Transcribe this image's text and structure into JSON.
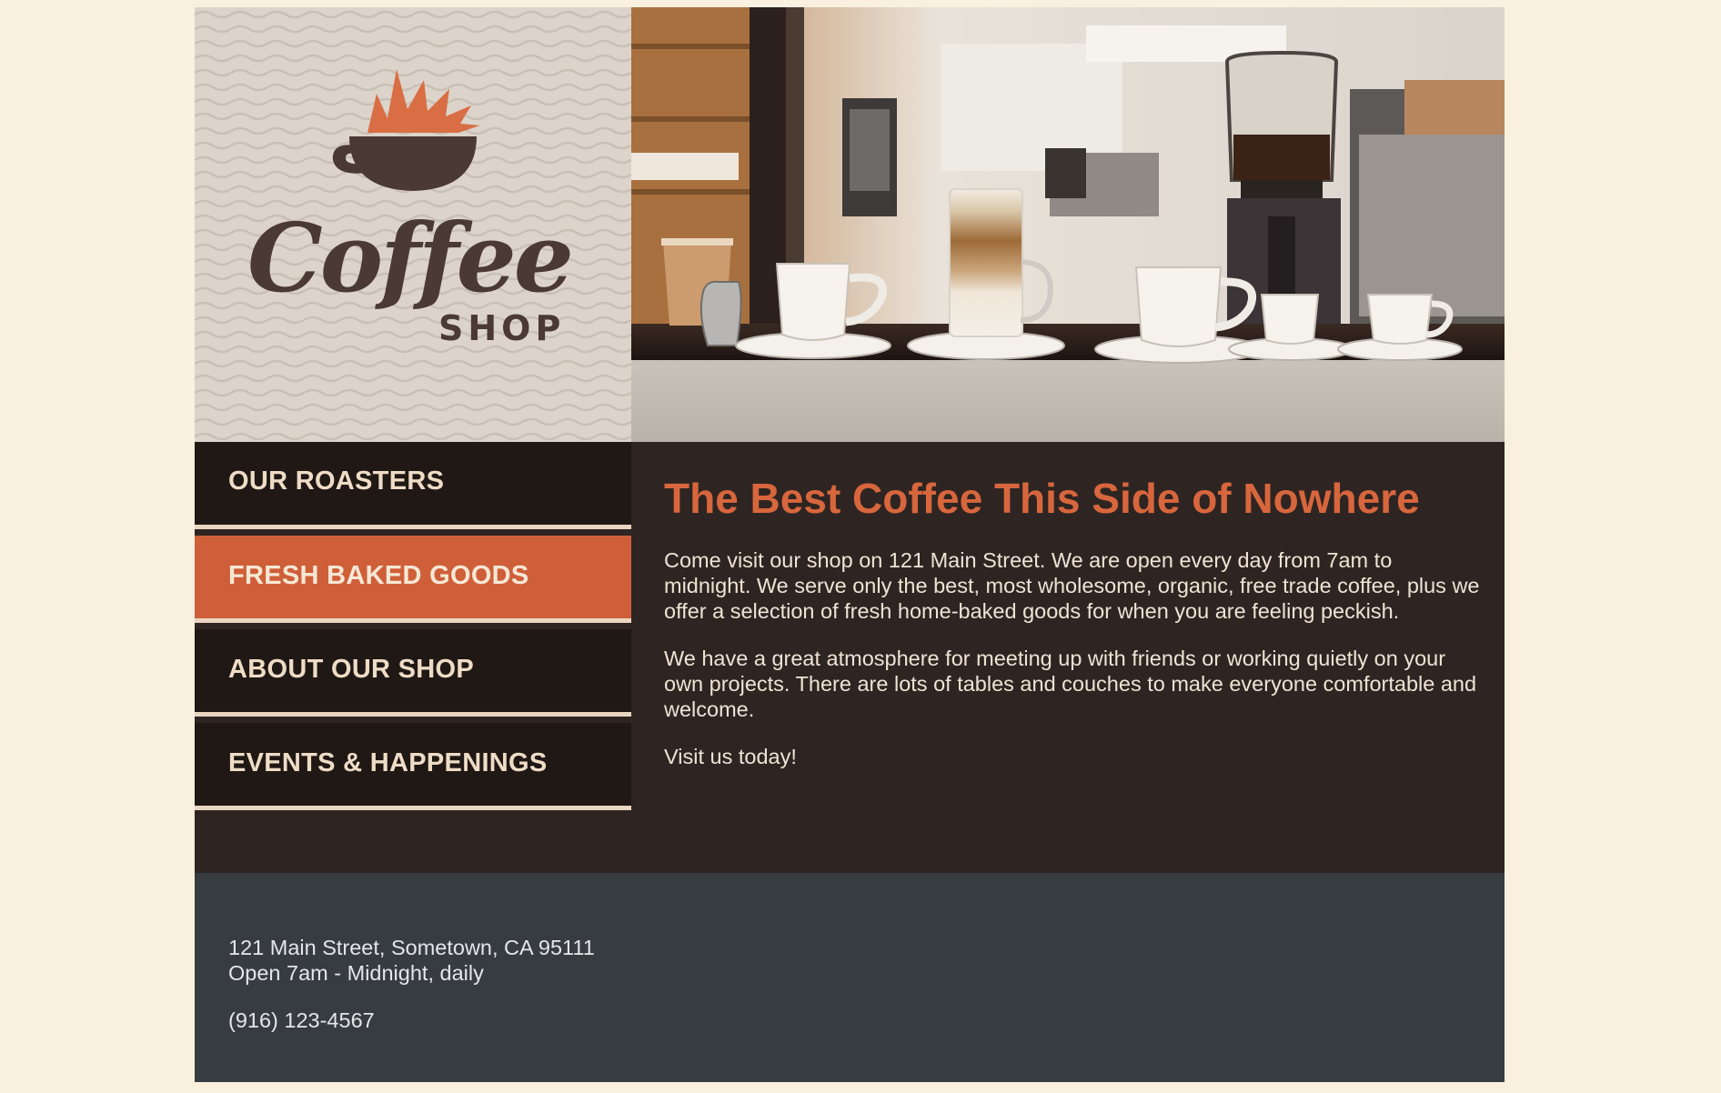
{
  "logo": {
    "word": "Coffee",
    "sub": "SHOP"
  },
  "hero": {
    "icon": "cafe-counter-photo"
  },
  "nav": {
    "items": [
      {
        "label": "OUR ROASTERS",
        "active": false
      },
      {
        "label": "FRESH BAKED GOODS",
        "active": true
      },
      {
        "label": "ABOUT OUR SHOP",
        "active": false
      },
      {
        "label": "EVENTS & HAPPENINGS",
        "active": false
      }
    ]
  },
  "content": {
    "title": "The Best Coffee This Side of Nowhere",
    "paragraphs": [
      "Come visit our shop on 121 Main Street. We are open every day from 7am to midnight. We serve only the best, most wholesome, organic, free trade coffee, plus we offer a selection of fresh home-baked goods for when you are feeling peckish.",
      "We have a great atmosphere for meeting up with friends or working quietly on your own projects. There are lots of tables and couches to make everyone comfortable and welcome.",
      "Visit us today!"
    ]
  },
  "footer": {
    "address": "121 Main Street, Sometown, CA 95111",
    "hours": "Open 7am - Midnight, daily",
    "phone": "(916) 123-4567"
  },
  "colors": {
    "background": "#faf0df",
    "accent": "#cf5f39",
    "nav_dark": "#1f1814",
    "content_bg": "#2e2522",
    "footer_bg": "#363c40"
  }
}
